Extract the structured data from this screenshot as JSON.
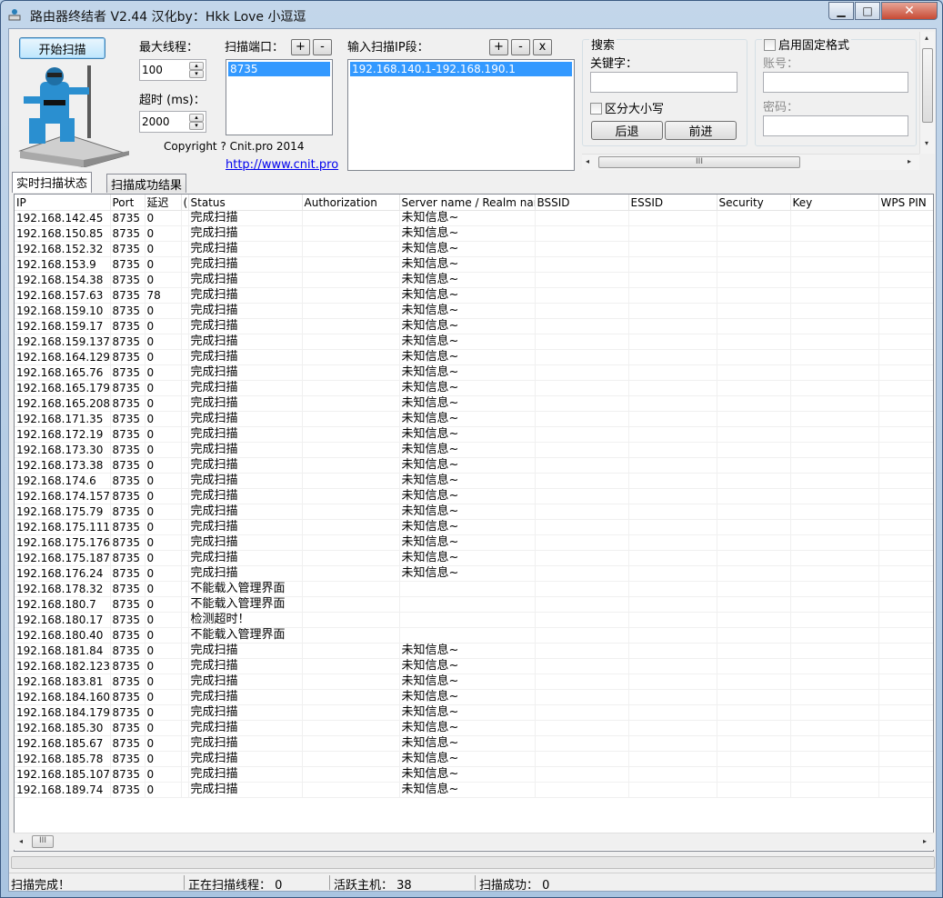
{
  "window": {
    "title": "路由器终结者 V2.44 汉化by：Hkk Love 小逗逗",
    "min_glyph": "▁",
    "max_glyph": "□",
    "close_glyph": "✕"
  },
  "controls": {
    "start_button": "开始扫描",
    "max_threads_label": "最大线程：",
    "max_threads_value": "100",
    "timeout_label": "超时 (ms)：",
    "timeout_value": "2000",
    "copyright": "Copyright ? Cnit.pro 2014",
    "website": "http://www.cnit.pro",
    "ports_label": "扫描端口：",
    "ports": [
      "8735"
    ],
    "ip_label": "输入扫描IP段：",
    "ip_ranges": [
      "192.168.140.1-192.168.190.1"
    ],
    "add": "+",
    "remove": "-",
    "clear": "x"
  },
  "search": {
    "title": "搜索",
    "keyword_label": "关键字：",
    "keyword_value": "",
    "case_sensitive": "区分大小写",
    "back": "后退",
    "forward": "前进"
  },
  "fixed_format": {
    "enable_label": "启用固定格式",
    "account_label": "账号：",
    "password_label": "密码："
  },
  "tabs": [
    "实时扫描状态",
    "扫描成功结果"
  ],
  "table": {
    "columns": [
      "IP",
      "Port",
      "延迟",
      "(",
      "Status",
      "Authorization",
      "Server name / Realm name",
      "BSSID",
      "ESSID",
      "Security",
      "Key",
      "WPS PIN"
    ],
    "rows": [
      [
        "192.168.142.45",
        "8735",
        "0",
        "完成扫描",
        "",
        "未知信息~"
      ],
      [
        "192.168.150.85",
        "8735",
        "0",
        "完成扫描",
        "",
        "未知信息~"
      ],
      [
        "192.168.152.32",
        "8735",
        "0",
        "完成扫描",
        "",
        "未知信息~"
      ],
      [
        "192.168.153.9",
        "8735",
        "0",
        "完成扫描",
        "",
        "未知信息~"
      ],
      [
        "192.168.154.38",
        "8735",
        "0",
        "完成扫描",
        "",
        "未知信息~"
      ],
      [
        "192.168.157.63",
        "8735",
        "78",
        "完成扫描",
        "",
        "未知信息~"
      ],
      [
        "192.168.159.10",
        "8735",
        "0",
        "完成扫描",
        "",
        "未知信息~"
      ],
      [
        "192.168.159.17",
        "8735",
        "0",
        "完成扫描",
        "",
        "未知信息~"
      ],
      [
        "192.168.159.137",
        "8735",
        "0",
        "完成扫描",
        "",
        "未知信息~"
      ],
      [
        "192.168.164.129",
        "8735",
        "0",
        "完成扫描",
        "",
        "未知信息~"
      ],
      [
        "192.168.165.76",
        "8735",
        "0",
        "完成扫描",
        "",
        "未知信息~"
      ],
      [
        "192.168.165.179",
        "8735",
        "0",
        "完成扫描",
        "",
        "未知信息~"
      ],
      [
        "192.168.165.208",
        "8735",
        "0",
        "完成扫描",
        "",
        "未知信息~"
      ],
      [
        "192.168.171.35",
        "8735",
        "0",
        "完成扫描",
        "",
        "未知信息~"
      ],
      [
        "192.168.172.19",
        "8735",
        "0",
        "完成扫描",
        "",
        "未知信息~"
      ],
      [
        "192.168.173.30",
        "8735",
        "0",
        "完成扫描",
        "",
        "未知信息~"
      ],
      [
        "192.168.173.38",
        "8735",
        "0",
        "完成扫描",
        "",
        "未知信息~"
      ],
      [
        "192.168.174.6",
        "8735",
        "0",
        "完成扫描",
        "",
        "未知信息~"
      ],
      [
        "192.168.174.157",
        "8735",
        "0",
        "完成扫描",
        "",
        "未知信息~"
      ],
      [
        "192.168.175.79",
        "8735",
        "0",
        "完成扫描",
        "",
        "未知信息~"
      ],
      [
        "192.168.175.111",
        "8735",
        "0",
        "完成扫描",
        "",
        "未知信息~"
      ],
      [
        "192.168.175.176",
        "8735",
        "0",
        "完成扫描",
        "",
        "未知信息~"
      ],
      [
        "192.168.175.187",
        "8735",
        "0",
        "完成扫描",
        "",
        "未知信息~"
      ],
      [
        "192.168.176.24",
        "8735",
        "0",
        "完成扫描",
        "",
        "未知信息~"
      ],
      [
        "192.168.178.32",
        "8735",
        "0",
        "不能载入管理界面",
        "",
        ""
      ],
      [
        "192.168.180.7",
        "8735",
        "0",
        "不能载入管理界面",
        "",
        ""
      ],
      [
        "192.168.180.17",
        "8735",
        "0",
        "检测超时！",
        "",
        ""
      ],
      [
        "192.168.180.40",
        "8735",
        "0",
        "不能载入管理界面",
        "",
        ""
      ],
      [
        "192.168.181.84",
        "8735",
        "0",
        "完成扫描",
        "",
        "未知信息~"
      ],
      [
        "192.168.182.123",
        "8735",
        "0",
        "完成扫描",
        "",
        "未知信息~"
      ],
      [
        "192.168.183.81",
        "8735",
        "0",
        "完成扫描",
        "",
        "未知信息~"
      ],
      [
        "192.168.184.160",
        "8735",
        "0",
        "完成扫描",
        "",
        "未知信息~"
      ],
      [
        "192.168.184.179",
        "8735",
        "0",
        "完成扫描",
        "",
        "未知信息~"
      ],
      [
        "192.168.185.30",
        "8735",
        "0",
        "完成扫描",
        "",
        "未知信息~"
      ],
      [
        "192.168.185.67",
        "8735",
        "0",
        "完成扫描",
        "",
        "未知信息~"
      ],
      [
        "192.168.185.78",
        "8735",
        "0",
        "完成扫描",
        "",
        "未知信息~"
      ],
      [
        "192.168.185.107",
        "8735",
        "0",
        "完成扫描",
        "",
        "未知信息~"
      ],
      [
        "192.168.189.74",
        "8735",
        "0",
        "完成扫描",
        "",
        "未知信息~"
      ]
    ]
  },
  "statusbar": {
    "status": "扫描完成！",
    "threads": "正在扫描线程： 0",
    "active_hosts": "活跃主机： 38",
    "success": "扫描成功： 0"
  },
  "scroll": {
    "thumb_glyph": "III",
    "left": "◂",
    "right": "▸",
    "up": "▴",
    "down": "▾"
  }
}
